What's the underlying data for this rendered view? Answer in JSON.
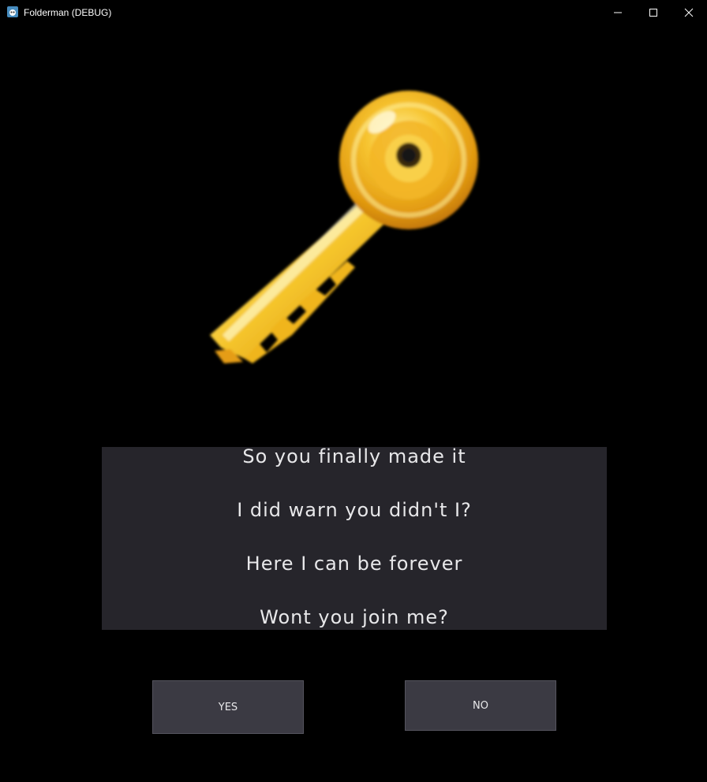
{
  "window": {
    "title": "Folderman (DEBUG)",
    "app_icon": "godot-engine-icon",
    "controls": {
      "minimize": "minimize-icon",
      "maximize": "maximize-icon",
      "close": "close-icon"
    }
  },
  "scene": {
    "image": "golden-key",
    "dialog": {
      "lines": [
        "So you finally made it",
        "I did warn you didn't I?",
        "Here I can be  forever",
        "Wont you join me?"
      ]
    },
    "choices": {
      "yes_label": "YES",
      "no_label": "NO"
    }
  },
  "colors": {
    "background": "#000000",
    "dialog_box": "#26252b",
    "button": "#3b3a43",
    "text": "#e8e8ea",
    "key_gold": "#f2b51c"
  }
}
